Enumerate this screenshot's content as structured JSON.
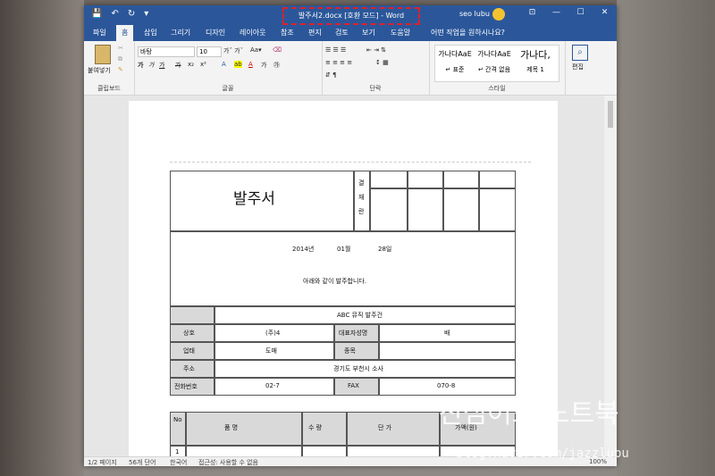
{
  "window": {
    "title": "발주서2.docx [호환 모드] - Word",
    "user": "seo lubu",
    "qat": [
      "💾",
      "↶",
      "↻",
      "▾"
    ],
    "controls": [
      "⊡",
      "—",
      "☐",
      "✕"
    ]
  },
  "tabs": [
    "파일",
    "홈",
    "삽입",
    "그리기",
    "디자인",
    "레이아웃",
    "참조",
    "편지",
    "검토",
    "보기",
    "도움말"
  ],
  "tell_me": "어떤 작업을 원하시나요?",
  "ribbon": {
    "paste_label": "붙여넣기",
    "clipboard_label": "클립보드",
    "font_name": "바탕",
    "font_size": "10",
    "font_group_label": "글꼴",
    "paragraph_label": "단락",
    "styles_label": "스타일",
    "style_normal_sample": "가나다AaE",
    "style_normal": "↵ 표준",
    "style_nospace_sample": "가나다AaE",
    "style_nospace": "↵ 간격 없음",
    "style_h1_sample": "가나다,",
    "style_h1": "제목 1",
    "edit_label": "편집",
    "font_buttons": [
      "가",
      "가",
      "가",
      "가",
      "가"
    ],
    "format_buttons": [
      "가",
      "가",
      "가",
      "x₂",
      "x²"
    ]
  },
  "document": {
    "title": "발주서",
    "approval_label": [
      "결",
      "재",
      "란"
    ],
    "date_year": "2014년",
    "date_month": "01월",
    "date_day": "28일",
    "intro": "아래와 같이 발주합니다.",
    "subject": "ABC 뮤직 발주건",
    "rows": [
      {
        "label1": "상호",
        "value1": "(주)4",
        "label2": "대표자성명",
        "value2": "배"
      },
      {
        "label1": "업태",
        "value1": "도매",
        "label2": "종목",
        "value2": ""
      },
      {
        "label1": "주소",
        "value1": "경기도 부천시 소사"
      },
      {
        "label1": "전화번호",
        "value1": "02-7",
        "label2": "FAX",
        "value2": "070-8"
      }
    ],
    "items_header": {
      "no": "No",
      "name": "품    명",
      "qty": "수    량",
      "price": "단    가",
      "amount": "가액(원)"
    },
    "first_no": "1"
  },
  "status": {
    "page": "1/2 페이지",
    "words": "56개 단어",
    "lang": "한국어",
    "accessibility": "접근성: 사용할 수 없음",
    "zoom": "100%"
  },
  "watermark": {
    "main": "진심어포 노트북",
    "sub": "blog.naver.com/jazzlubu"
  }
}
